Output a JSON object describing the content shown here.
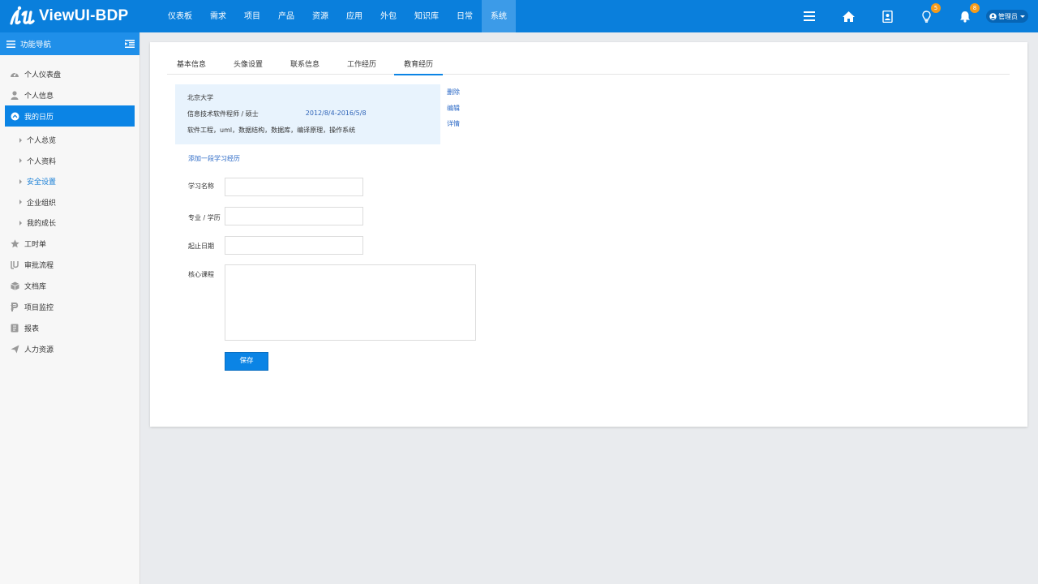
{
  "brand": {
    "name": "ViewUI-BDP"
  },
  "topnav": [
    "仪表板",
    "需求",
    "项目",
    "产品",
    "资源",
    "应用",
    "外包",
    "知识库",
    "日常",
    "系统"
  ],
  "topnav_active": "系统",
  "topbar": {
    "bulb_badge": "5",
    "bell_badge": "8",
    "user": "管理员"
  },
  "sidebar": {
    "title": "功能导航",
    "items": [
      {
        "label": "个人仪表盘",
        "icon": "dashboard-icon"
      },
      {
        "label": "个人信息",
        "icon": "user-icon"
      },
      {
        "label": "我的日历",
        "icon": "calendar-icon",
        "active": true
      },
      {
        "label": "个人总览",
        "sub": true
      },
      {
        "label": "个人资料",
        "sub": true
      },
      {
        "label": "安全设置",
        "sub": true,
        "active": true
      },
      {
        "label": "企业组织",
        "sub": true
      },
      {
        "label": "我的成长",
        "sub": true
      },
      {
        "label": "工时单",
        "icon": "star-icon"
      },
      {
        "label": "审批流程",
        "icon": "flow-icon"
      },
      {
        "label": "文档库",
        "icon": "box-icon"
      },
      {
        "label": "项目监控",
        "icon": "monitor-icon"
      },
      {
        "label": "报表",
        "icon": "report-icon"
      },
      {
        "label": "人力资源",
        "icon": "send-icon"
      }
    ]
  },
  "tabs": [
    "基本信息",
    "头像设置",
    "联系信息",
    "工作经历",
    "教育经历"
  ],
  "active_tab": "教育经历",
  "education": {
    "school": "北京大学",
    "major": "信息技术软件程师 / 硕士",
    "date": "2012/8/4-2016/5/8",
    "courses": "软件工程，uml，数据结构，数据库，编译原理，操作系统",
    "actions": {
      "delete": "删除",
      "edit": "编辑",
      "detail": "详情"
    },
    "add_link": "添加一段学习经历"
  },
  "form": {
    "name_label": "学习名称",
    "major_label": "专业 / 学历",
    "date_label": "起止日期",
    "courses_label": "核心课程",
    "save": "保存"
  },
  "colors": {
    "primary": "#0a7fdc",
    "accent": "#0b84e5",
    "badge": "#f59b1a",
    "link": "#2a68c6"
  }
}
